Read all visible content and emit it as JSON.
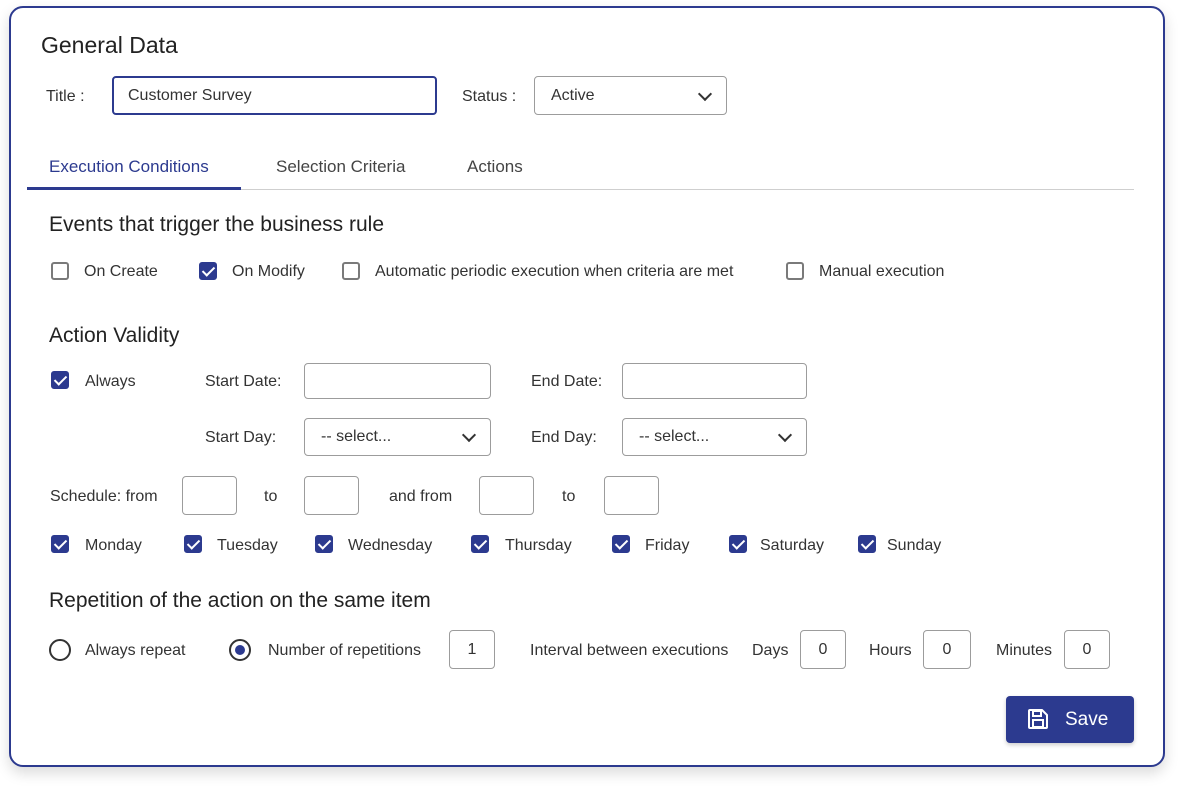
{
  "general": {
    "heading": "General Data",
    "title_label": "Title :",
    "title_value": "Customer Survey",
    "status_label": "Status :",
    "status_value": "Active"
  },
  "tabs": [
    {
      "label": "Execution Conditions",
      "active": true
    },
    {
      "label": "Selection Criteria",
      "active": false
    },
    {
      "label": "Actions",
      "active": false
    }
  ],
  "events": {
    "heading": "Events that trigger the business rule",
    "items": [
      {
        "label": "On Create",
        "checked": false
      },
      {
        "label": "On Modify",
        "checked": true
      },
      {
        "label": "Automatic periodic execution when criteria are met",
        "checked": false
      },
      {
        "label": "Manual execution",
        "checked": false
      }
    ]
  },
  "validity": {
    "heading": "Action Validity",
    "always_label": "Always",
    "always_checked": true,
    "start_date_label": "Start Date:",
    "start_date_value": "",
    "end_date_label": "End Date:",
    "end_date_value": "",
    "start_day_label": "Start Day:",
    "start_day_value": "-- select...",
    "end_day_label": "End Day:",
    "end_day_value": "-- select...",
    "schedule_from_label": "Schedule: from",
    "to_label": "to",
    "and_from_label": "and from",
    "to2_label": "to",
    "days": [
      {
        "label": "Monday",
        "checked": true
      },
      {
        "label": "Tuesday",
        "checked": true
      },
      {
        "label": "Wednesday",
        "checked": true
      },
      {
        "label": "Thursday",
        "checked": true
      },
      {
        "label": "Friday",
        "checked": true
      },
      {
        "label": "Saturday",
        "checked": true
      },
      {
        "label": "Sunday",
        "checked": true
      }
    ]
  },
  "repetition": {
    "heading": "Repetition of the action on the same item",
    "always_repeat_label": "Always repeat",
    "number_label": "Number of repetitions",
    "number_value": "1",
    "interval_label": "Interval between executions",
    "days_label": "Days",
    "days_value": "0",
    "hours_label": "Hours",
    "hours_value": "0",
    "minutes_label": "Minutes",
    "minutes_value": "0"
  },
  "save_label": "Save",
  "icons": {
    "save": "save-icon",
    "dropdown": "chevron-down-icon"
  },
  "colors": {
    "accent": "#2c3a8f"
  }
}
